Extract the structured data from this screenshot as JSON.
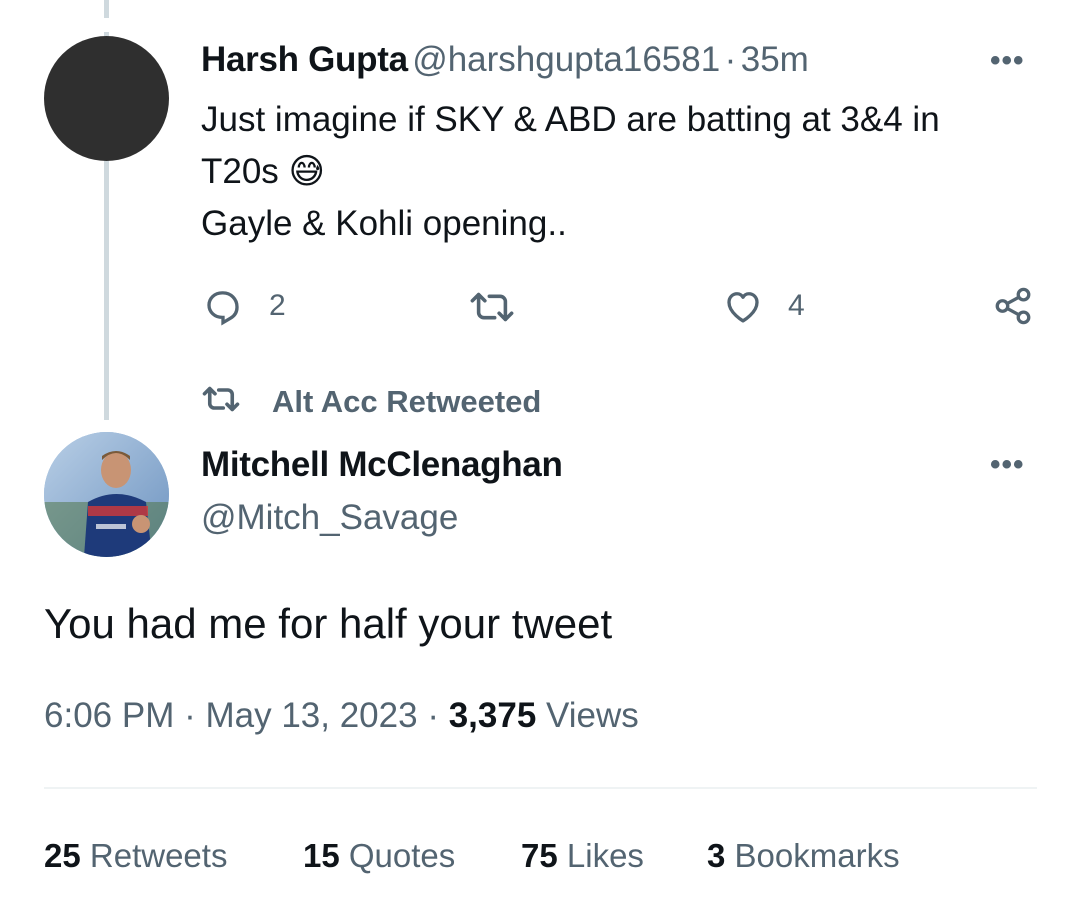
{
  "parent_tweet": {
    "display_name": "Harsh Gupta",
    "handle": "@harshgupta16581",
    "separator": "·",
    "time_ago": "35m",
    "more_label": "•••",
    "text_line1": "Just imagine if SKY & ABD are batting at 3&4 in",
    "text_line2": "T20s",
    "emoji": "😅",
    "text_line3": "Gayle & Kohli opening..",
    "reply_count": "2",
    "like_count": "4",
    "icons": [
      "reply-icon",
      "retweet-icon",
      "like-icon",
      "share-icon"
    ]
  },
  "retweet_banner": {
    "label": "Alt Acc Retweeted",
    "icon": "retweet-icon"
  },
  "main_tweet": {
    "display_name": "Mitchell McClenaghan",
    "handle": "@Mitch_Savage",
    "more_label": "•••",
    "text": "You had me for half your tweet",
    "time": "6:06 PM",
    "separator1": "·",
    "date": "May 13, 2023",
    "separator2": "·",
    "views_count": "3,375",
    "views_label": "Views"
  },
  "stats": {
    "retweets_count": "25",
    "retweets_label": "Retweets",
    "quotes_count": "15",
    "quotes_label": "Quotes",
    "likes_count": "75",
    "likes_label": "Likes",
    "bookmarks_count": "3",
    "bookmarks_label": "Bookmarks"
  },
  "colors": {
    "text_primary": "#0f1419",
    "text_secondary": "#536471",
    "thread_line": "#cfd9de",
    "divider": "#eff3f4",
    "avatar_dark": "#2f2f2f"
  }
}
